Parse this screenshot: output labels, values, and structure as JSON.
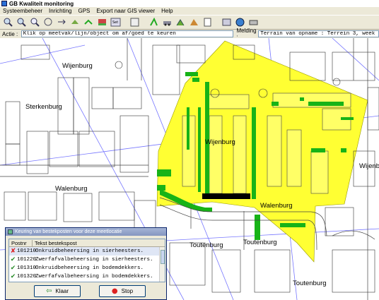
{
  "window": {
    "title": "GB Kwaliteit monitoring"
  },
  "menu": [
    "Systeembeheer",
    "Inrichting",
    "GPS",
    "Export naar GIS viewer",
    "Help"
  ],
  "toolbar_icons": [
    "zoom-in-icon",
    "zoom-out-icon",
    "zoom-window-icon",
    "zoom-previous-icon",
    "zoom-next-icon",
    "full-extent-icon",
    "pan-icon",
    "layers-icon",
    "settings-icon",
    "measure-icon",
    "select-icon",
    "car-icon",
    "route-icon",
    "map-icon",
    "export-icon",
    "gps-icon",
    "globe-icon",
    "print-icon"
  ],
  "action": {
    "label": "Actie :",
    "value": "Klik op meetvak/lijn/object om af/goed te keuren"
  },
  "message": {
    "label": "Melding :",
    "value": "Terrain van opname : Terrein 3, week 23"
  },
  "streets": [
    "Wijenburg",
    "Sterkenburg",
    "Wijenburg",
    "Walenburg",
    "Wijenb",
    "Walenburg",
    "Toutenburg",
    "Toutenburg",
    "Toutenburg"
  ],
  "colors": {
    "highlight": "#ffff33",
    "green": "#17b317",
    "black": "#000000",
    "lines": "#7777ff"
  },
  "dialog": {
    "title": "Keuring van bestekposten voor deze meetlocatie",
    "columns": [
      "Postnr",
      "Tekst bestekspost"
    ],
    "rows": [
      {
        "status": "x",
        "code": "101210",
        "text": "Onkruidbeheersing in sierheesters."
      },
      {
        "status": "ok",
        "code": "101220",
        "text": "Zwerfafvalbeheersing in sierheesters."
      },
      {
        "status": "ok",
        "code": "101310",
        "text": "Onkruidbeheersing in bodemdekkers."
      },
      {
        "status": "ok",
        "code": "101320",
        "text": "Zwerfafvalbeheersing in bodemdekkers."
      }
    ],
    "ok_label": "Klaar",
    "stop_label": "Stop"
  }
}
